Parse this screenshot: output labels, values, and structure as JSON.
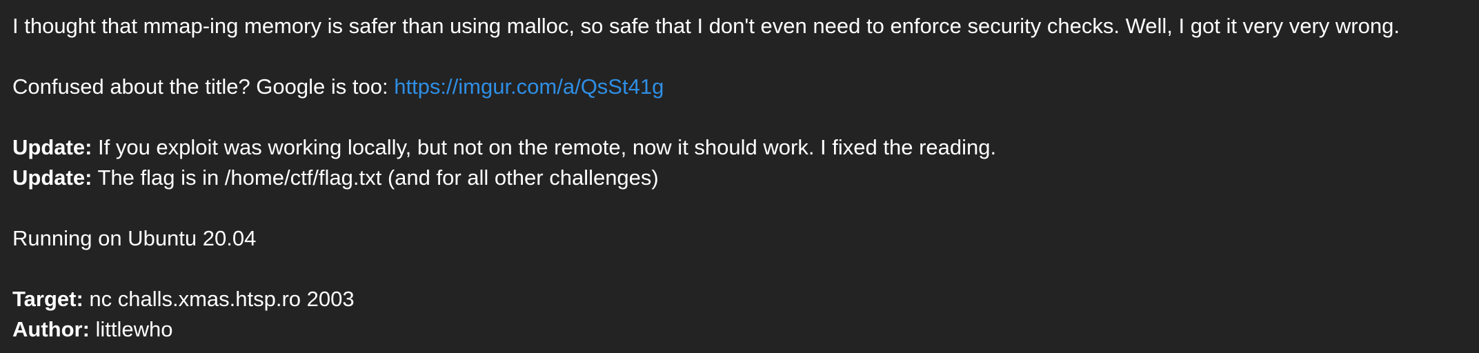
{
  "description": {
    "intro": "I thought that mmap-ing memory is safer than using malloc, so safe that I don't even need to enforce security checks. Well, I got it very very wrong.",
    "title_hint_text": "Confused about the title? Google is too: ",
    "title_hint_link": "https://imgur.com/a/QsSt41g",
    "update1_label": "Update:",
    "update1_text": " If you exploit was working locally, but not on the remote, now it should work. I fixed the reading.",
    "update2_label": "Update:",
    "update2_text": " The flag is in /home/ctf/flag.txt (and for all other challenges)",
    "running_on": "Running on Ubuntu 20.04",
    "target_label": "Target:",
    "target_value": " nc challs.xmas.htsp.ro 2003",
    "author_label": "Author:",
    "author_value": " littlewho"
  },
  "colors": {
    "background": "#232323",
    "text": "#ffffff",
    "link": "#2f8fe6"
  }
}
